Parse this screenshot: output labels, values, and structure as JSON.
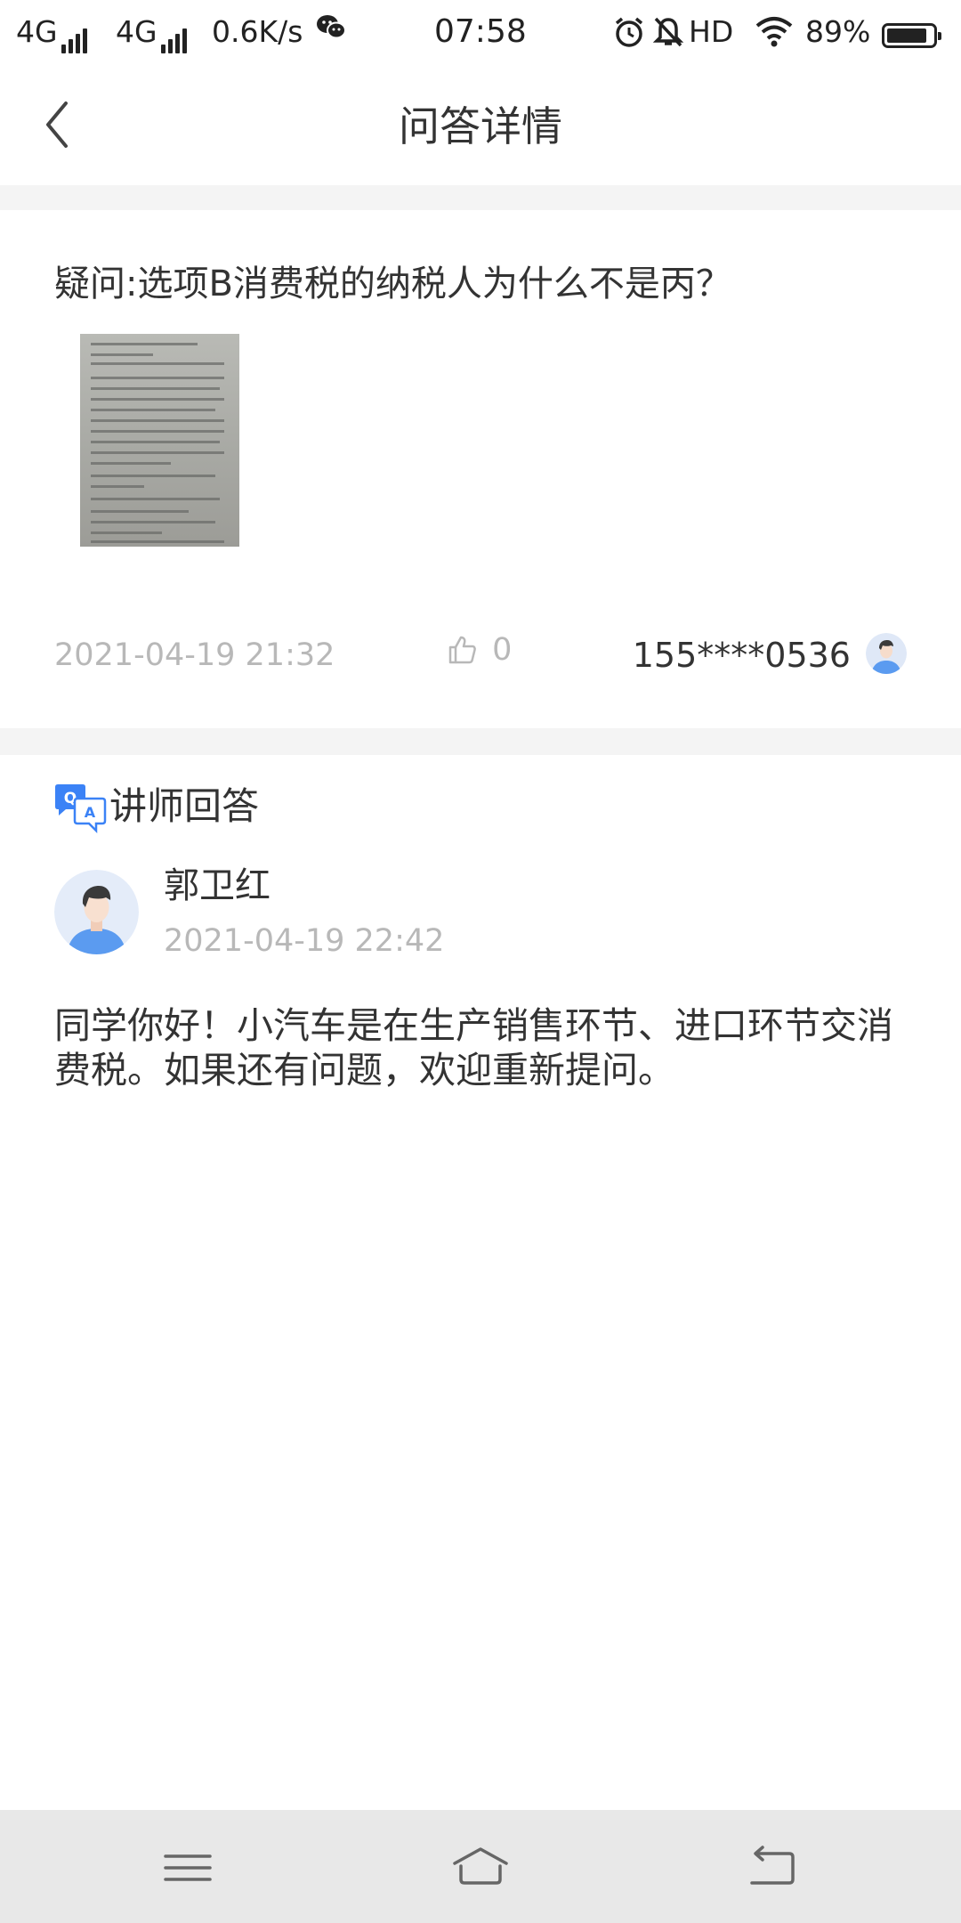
{
  "status_bar": {
    "network_1": "4G",
    "network_2": "4G",
    "speed": "0.6K/s",
    "time": "07:58",
    "hd": "HD",
    "battery": "89%",
    "icons": [
      "signal-icon",
      "wechat-icon",
      "alarm-icon",
      "mute-icon",
      "wifi-icon",
      "battery-icon"
    ]
  },
  "header": {
    "title": "问答详情",
    "back_icon": "chevron-left-icon"
  },
  "question": {
    "text": "疑问:选项B消费税的纳税人为什么不是丙？",
    "date": "2021-04-19 21:32",
    "like_count": "0",
    "asker_id": "155****0536"
  },
  "answer": {
    "section_title": "讲师回答",
    "teacher_name": "郭卫红",
    "date": "2021-04-19 22:42",
    "text": "同学你好！小汽车是在生产销售环节、进口环节交消费税。如果还有问题，欢迎重新提问。"
  },
  "nav": {
    "icons": [
      "menu-icon",
      "home-icon",
      "back-icon"
    ]
  },
  "colors": {
    "accent_blue": "#3b82f6",
    "separator": "#f4f4f4",
    "muted_text": "#b8b8b8",
    "nav_bg": "#e8e8e8"
  }
}
